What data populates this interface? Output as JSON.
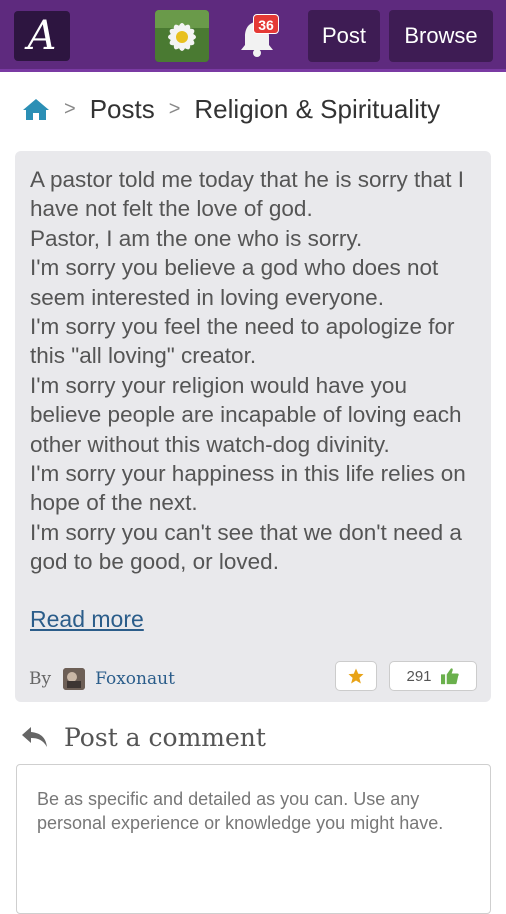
{
  "header": {
    "logo_letter": "A",
    "notification_count": "36",
    "post_label": "Post",
    "browse_label": "Browse",
    "colors": {
      "bar": "#5e2a7e",
      "button": "#3e1c54",
      "badge": "#e53935"
    }
  },
  "breadcrumb": {
    "items": [
      "Posts",
      "Religion & Spirituality"
    ],
    "home_icon": "home-icon"
  },
  "post": {
    "lines": [
      "A pastor told me today that he is sorry that I have not felt the love of god.",
      "Pastor, I am the one who is sorry.",
      "I'm sorry you believe a god who does not seem interested in loving everyone.",
      "I'm sorry you feel the need to apologize for this \"all loving\" creator.",
      "I'm sorry your religion would have you believe people are incapable of loving each other without this watch-dog divinity.",
      "I'm sorry your happiness in this life relies on hope of the next.",
      "I'm sorry you can't see that we don't need a god to be good, or loved."
    ],
    "read_more": "Read more",
    "by_label": "By",
    "author": "Foxonaut",
    "like_count": "291"
  },
  "comment": {
    "heading": "Post a comment",
    "placeholder": "Be as specific and detailed as you can. Use any personal experience or knowledge you might have."
  }
}
